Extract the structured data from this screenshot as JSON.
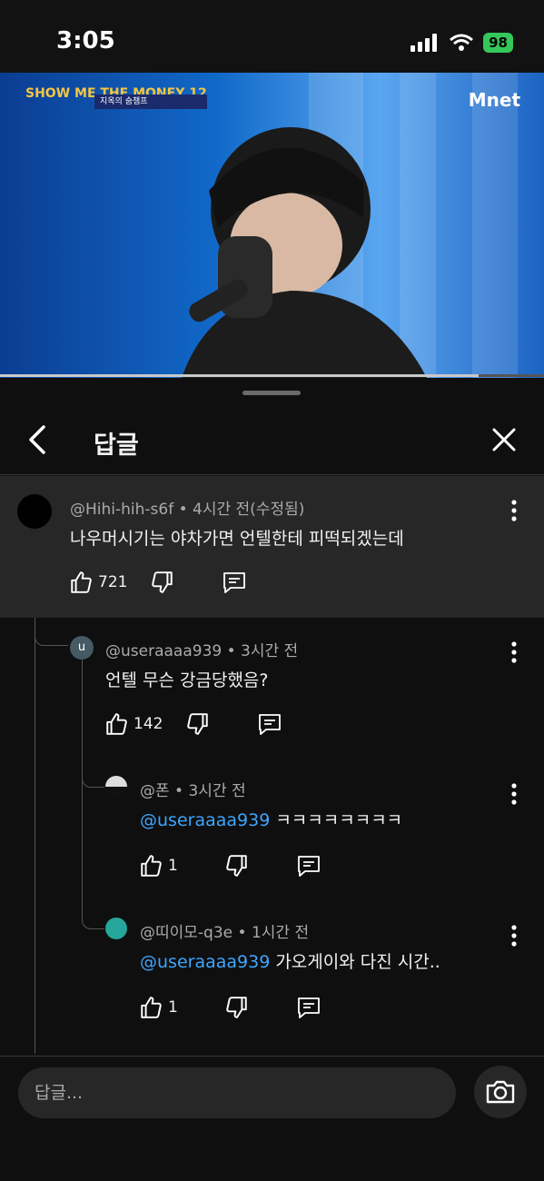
{
  "status": {
    "time": "3:05",
    "battery": "98"
  },
  "video": {
    "show_logo": "SHOW ME THE MONEY 12",
    "caption": "지옥의 숨챔프",
    "channel_logo": "Mnet",
    "progress": 0.88
  },
  "panel": {
    "title": "답글"
  },
  "comments": [
    {
      "author": "@Hihi-hih-s6f",
      "time": "4시간 전(수정됨)",
      "text": "나우머시기는 야차가면 언텔한테 피떡되겠는데",
      "likes": "721"
    },
    {
      "author": "@useraaaa939",
      "time": "3시간 전",
      "avatar_letter": "u",
      "text": "언텔 무슨 강금당했음?",
      "likes": "142"
    },
    {
      "author": "@폰",
      "time": "3시간 전",
      "mention": "@useraaaa939",
      "text": " ㅋㅋㅋㅋㅋㅋㅋㅋ",
      "likes": "1"
    },
    {
      "author": "@띠이모-q3e",
      "time": "1시간 전",
      "mention": "@useraaaa939",
      "text": " 가오게이와 다진 시간..",
      "likes": "1"
    }
  ],
  "reply_input": {
    "placeholder": "답글..."
  },
  "icons": [
    "signal-icon",
    "wifi-icon",
    "back-arrow-icon",
    "close-icon",
    "more-vert-icon",
    "like-icon",
    "dislike-icon",
    "reply-icon",
    "camera-icon"
  ]
}
